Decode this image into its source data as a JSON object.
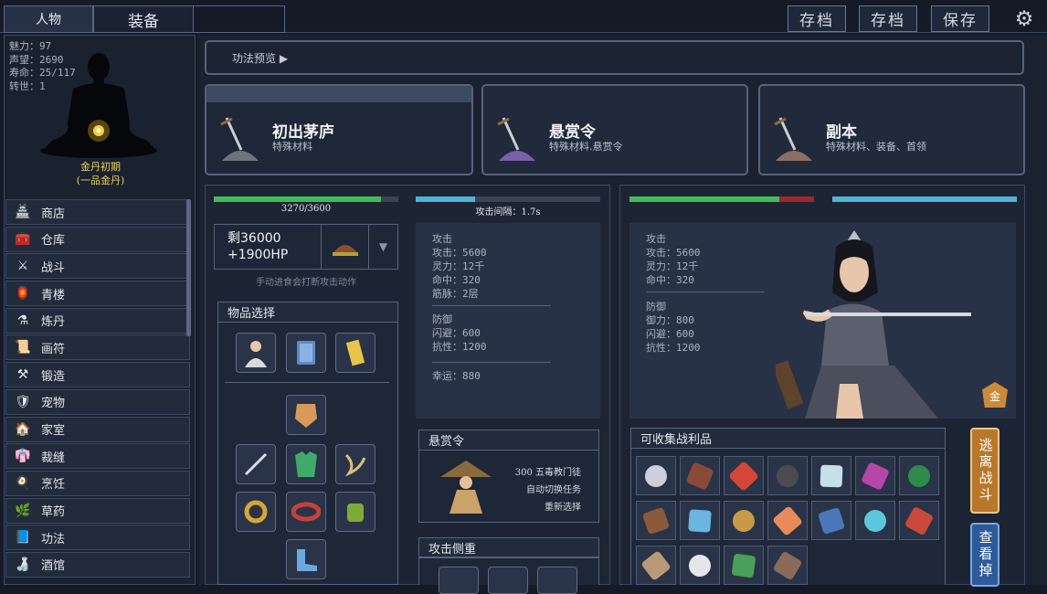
{
  "top": {
    "tab_char": "人物",
    "tab_equip": "装备",
    "save1": "存档",
    "save2": "存档",
    "save3": "保存"
  },
  "stats": [
    "魅力：97",
    "声望：2690",
    "寿命：25/117",
    "转世：1"
  ],
  "realm": [
    "金丹初期",
    "(一品金丹)"
  ],
  "menu": [
    {
      "label": "商店",
      "icon": "🏯"
    },
    {
      "label": "仓库",
      "icon": "🧰"
    },
    {
      "label": "战斗",
      "icon": "⚔"
    },
    {
      "label": "青楼",
      "icon": "🏮"
    },
    {
      "label": "炼丹",
      "icon": "⚗"
    },
    {
      "label": "画符",
      "icon": "📜"
    },
    {
      "label": "锻造",
      "icon": "⚒"
    },
    {
      "label": "宠物",
      "icon": "🛡"
    },
    {
      "label": "家室",
      "icon": "🏠"
    },
    {
      "label": "裁缝",
      "icon": "👘"
    },
    {
      "label": "烹饪",
      "icon": "🍳"
    },
    {
      "label": "草药",
      "icon": "🌿"
    },
    {
      "label": "功法",
      "icon": "📘"
    },
    {
      "label": "酒馆",
      "icon": "🍶"
    }
  ],
  "breadcrumb": "功法预览 ▶",
  "cards": [
    {
      "title": "初出茅庐",
      "sub": "特殊材料"
    },
    {
      "title": "悬赏令",
      "sub": "特殊材料.悬赏令"
    },
    {
      "title": "副本",
      "sub": "特殊材料、装备、首领"
    }
  ],
  "player": {
    "hp_text": "3270/3600",
    "hp_fraction": 0.908,
    "interval": "攻击间隔：1.7s",
    "interval_fraction": 0.32,
    "food_line1": "剩36000",
    "food_line2": "+1900HP",
    "hint": "手动进食会打断攻击动作",
    "attack": [
      "攻击",
      "攻击：5600",
      "灵力：12千",
      "命中：320",
      "筋脉：2层"
    ],
    "defense": [
      "防御",
      "闪避：600",
      "抗性：1200"
    ],
    "luck": "幸运：880"
  },
  "items_title": "物品选择",
  "bounty": {
    "title": "悬赏令",
    "line1": "300 五毒教门徒",
    "line2": "自动切换任务",
    "line3": "重新选择"
  },
  "attack_focus_title": "攻击侧重",
  "enemy": {
    "hp_fraction": 0.81,
    "speed_fraction": 1.0,
    "attack": [
      "攻击",
      "攻击：5600",
      "灵力：12千",
      "命中：320"
    ],
    "defense": [
      "防御",
      "御力：800",
      "闪避：600",
      "抗性：1200"
    ],
    "badge": "金"
  },
  "loot_title": "可收集战利品",
  "flee": "逃离战斗",
  "view_drop": "查看掉",
  "colors": {
    "hp": "#3fbd55",
    "speed": "#4fb3d8",
    "enemy_hp_lost": "#a0262b"
  }
}
